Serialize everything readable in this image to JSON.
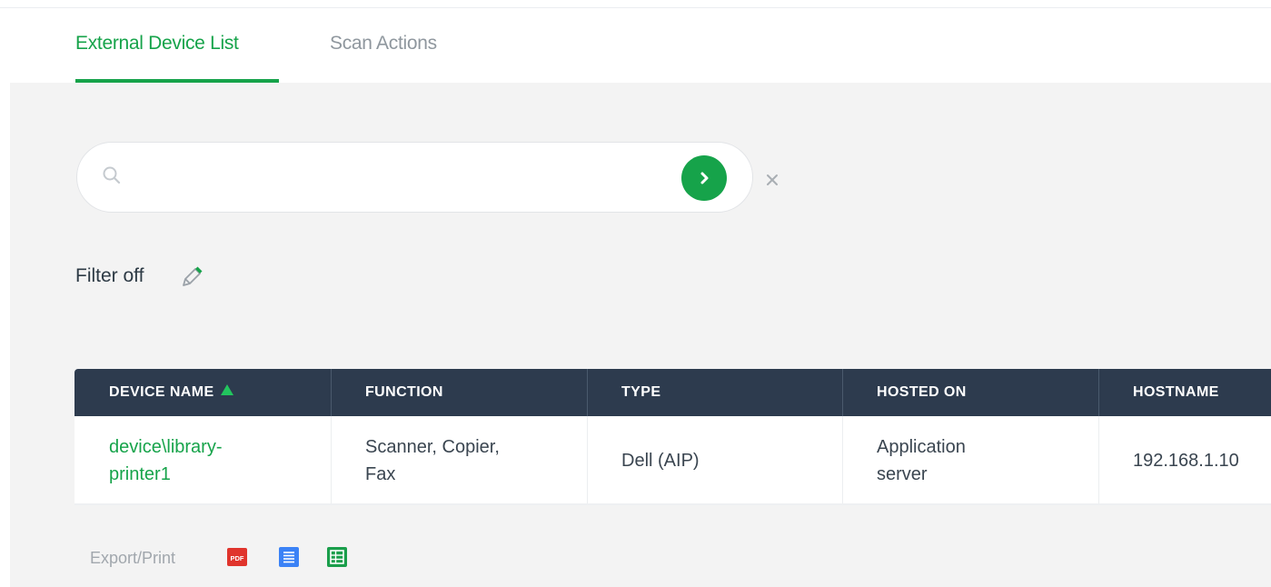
{
  "tabs": [
    {
      "label": "External Device List",
      "active": true
    },
    {
      "label": "Scan Actions",
      "active": false
    }
  ],
  "search": {
    "placeholder": "",
    "value": ""
  },
  "filter": {
    "label": "Filter off"
  },
  "table": {
    "columns": [
      "DEVICE NAME",
      "FUNCTION",
      "TYPE",
      "HOSTED ON",
      "HOSTNAME"
    ],
    "sort": {
      "column": "DEVICE NAME",
      "direction": "ascending"
    },
    "rows": [
      {
        "device_name": [
          "device\\library-",
          "printer1"
        ],
        "function": [
          "Scanner, Copier,",
          "Fax"
        ],
        "type": [
          "Dell (AIP)"
        ],
        "hosted_on": [
          "Application",
          "server"
        ],
        "hostname": [
          "192.168.1.10"
        ]
      }
    ]
  },
  "export": {
    "label": "Export/Print",
    "icons": [
      "pdf-icon",
      "csv-icon",
      "spreadsheet-icon"
    ],
    "pdf_text": "PDF"
  },
  "colors": {
    "accent": "#16a34a",
    "header_bg": "#2d3b4e",
    "content_bg": "#f3f3f3",
    "pdf_red": "#e0342c",
    "csv_blue": "#3b82f6",
    "sheet_green": "#1a9e4b"
  }
}
